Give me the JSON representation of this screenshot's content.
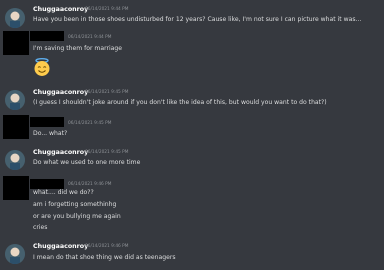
{
  "messages": [
    {
      "author": "Chuggaaconroy",
      "timestamp": "06/14/2021 9:44 PM",
      "lines": [
        "Have you been in those shoes undisturbed for 12 years? Cause like, I'm not sure I can picture what it was..."
      ]
    },
    {
      "author": "",
      "timestamp": "06/14/2021 9:44 PM",
      "lines": [
        "I'm saving them for marriage"
      ],
      "emoji": "innocent-face"
    },
    {
      "author": "Chuggaaconroy",
      "timestamp": "06/14/2021 9:45 PM",
      "lines": [
        "(I guess I shouldn't joke around if you don't like the idea of this, but would you want to do that?)"
      ]
    },
    {
      "author": "",
      "timestamp": "06/14/2021 9:45 PM",
      "lines": [
        "Do... what?"
      ]
    },
    {
      "author": "Chuggaaconroy",
      "timestamp": "06/14/2021 9:45 PM",
      "lines": [
        "Do what we used to one more time"
      ]
    },
    {
      "author": "",
      "timestamp": "06/14/2021 9:46 PM",
      "lines": [
        "what.... did we do??",
        "am i forgetting somethinhg",
        "or are you bullying me again",
        "cries"
      ]
    },
    {
      "author": "Chuggaaconroy",
      "timestamp": "06/14/2021 9:46 PM",
      "lines": [
        "I mean do that shoe thing we did as teenagers"
      ]
    }
  ]
}
